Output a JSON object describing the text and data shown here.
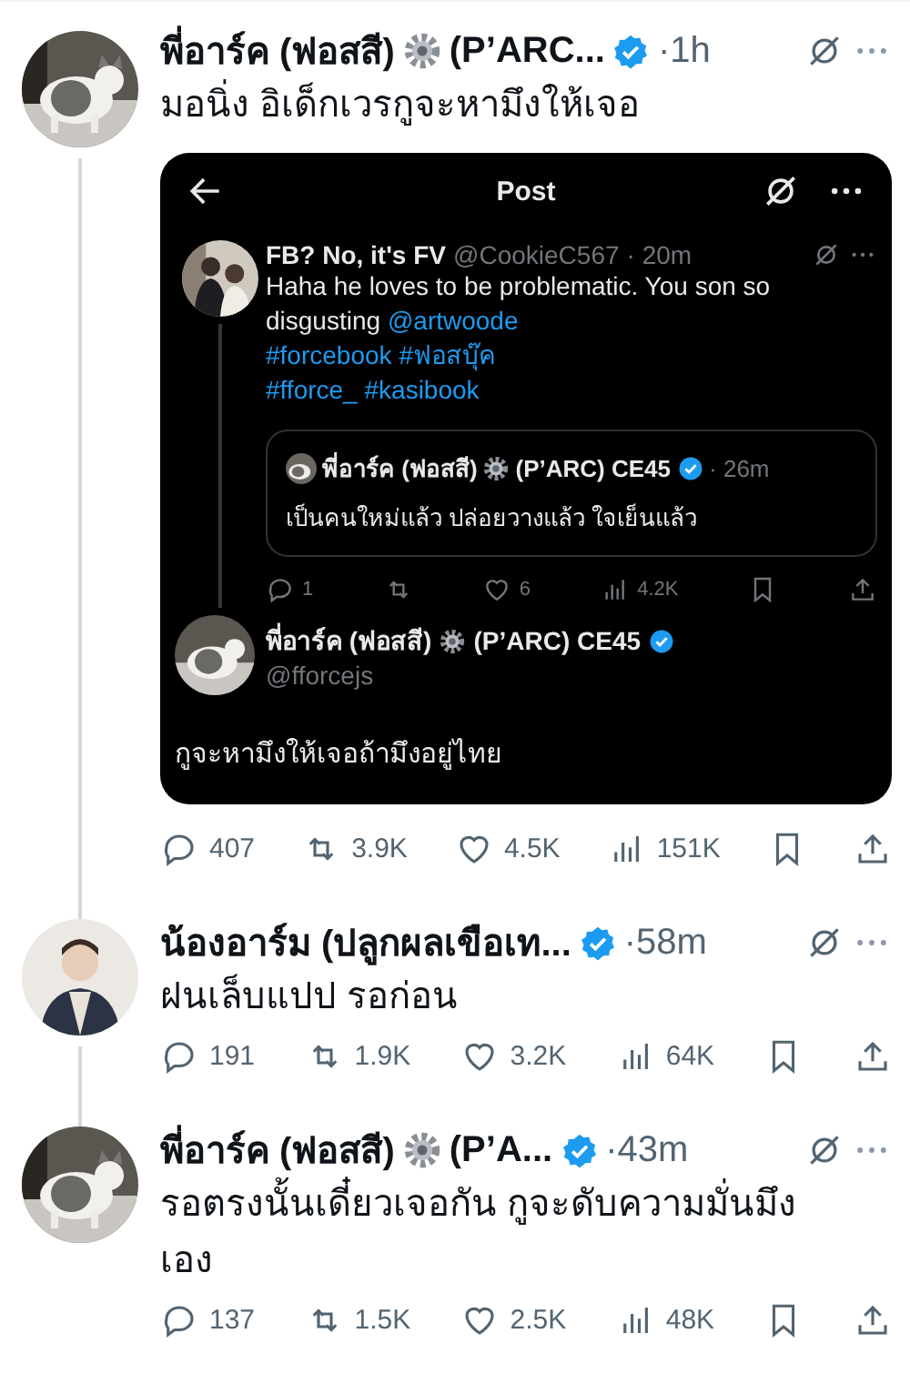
{
  "tweets": [
    {
      "author": "พี่อาร์ค (ฟอสสี)",
      "gear_badge": true,
      "author_tail": "(P’ARC...",
      "verified": true,
      "time": "·1h",
      "connected_below": true,
      "text": "มอนิ่ง อิเด็กเวรกูจะหามึงให้เจอ",
      "embedded": {
        "header": {
          "title": "Post"
        },
        "post": {
          "author": "FB? No, it's FV",
          "handle": "@CookieC567",
          "time": "· 20m",
          "lines": [
            [
              {
                "text": "Haha he loves to be problematic. You son so disgusting",
                "link": false
              },
              {
                "text": "@artwoode",
                "link": true
              }
            ],
            [
              {
                "text": "#forcebook",
                "link": true
              },
              {
                "text": "#ฟอสบุ๊ค",
                "link": true
              }
            ],
            [
              {
                "text": "#fforce_",
                "link": true
              },
              {
                "text": "#kasibook",
                "link": true
              }
            ]
          ],
          "quote": {
            "author": "พี่อาร์ค (ฟอสสี)",
            "gear_badge": true,
            "author_tail": "(P’ARC) CE45",
            "verified": true,
            "time": "· 26m",
            "text": "เป็นคนใหม่แล้ว ปล่อยวางแล้ว ใจเย็นแล้ว"
          },
          "stats": [
            {
              "kind": "reply",
              "count": "1"
            },
            {
              "kind": "repost"
            },
            {
              "kind": "like",
              "count": "6"
            },
            {
              "kind": "views",
              "count": "4.2K"
            },
            {
              "kind": "bookmark"
            },
            {
              "kind": "share"
            }
          ]
        },
        "reply": {
          "author": "พี่อาร์ค (ฟอสสี)",
          "gear_badge": true,
          "author_tail": "(P’ARC) CE45",
          "verified": true,
          "handle": "@fforcejs",
          "text": "กูจะหามึงให้เจอถ้ามึงอยู่ไทย"
        }
      },
      "stats": [
        {
          "kind": "reply",
          "count": "407"
        },
        {
          "kind": "repost",
          "count": "3.9K"
        },
        {
          "kind": "like",
          "count": "4.5K"
        },
        {
          "kind": "views",
          "count": "151K"
        },
        {
          "kind": "bookmark"
        },
        {
          "kind": "share"
        }
      ]
    },
    {
      "author": "น้องอาร์ม (ปลูกผลเขือเท...",
      "gear_badge": false,
      "verified": true,
      "time": "·58m",
      "connected_below": true,
      "text": "ฝนเล็บแปป รอก่อน",
      "stats": [
        {
          "kind": "reply",
          "count": "191"
        },
        {
          "kind": "repost",
          "count": "1.9K"
        },
        {
          "kind": "like",
          "count": "3.2K"
        },
        {
          "kind": "views",
          "count": "64K"
        },
        {
          "kind": "bookmark"
        },
        {
          "kind": "share"
        }
      ]
    },
    {
      "author": "พี่อาร์ค (ฟอสสี)",
      "gear_badge": true,
      "author_tail": "(P’A...",
      "verified": true,
      "time": "·43m",
      "connected_below": false,
      "text": "รอตรงนั้นเดี๋ยวเจอกัน กูจะดับความมั่นมึงเอง",
      "stats": [
        {
          "kind": "reply",
          "count": "137"
        },
        {
          "kind": "repost",
          "count": "1.5K"
        },
        {
          "kind": "like",
          "count": "2.5K"
        },
        {
          "kind": "views",
          "count": "48K"
        },
        {
          "kind": "bookmark"
        },
        {
          "kind": "share"
        }
      ]
    }
  ]
}
